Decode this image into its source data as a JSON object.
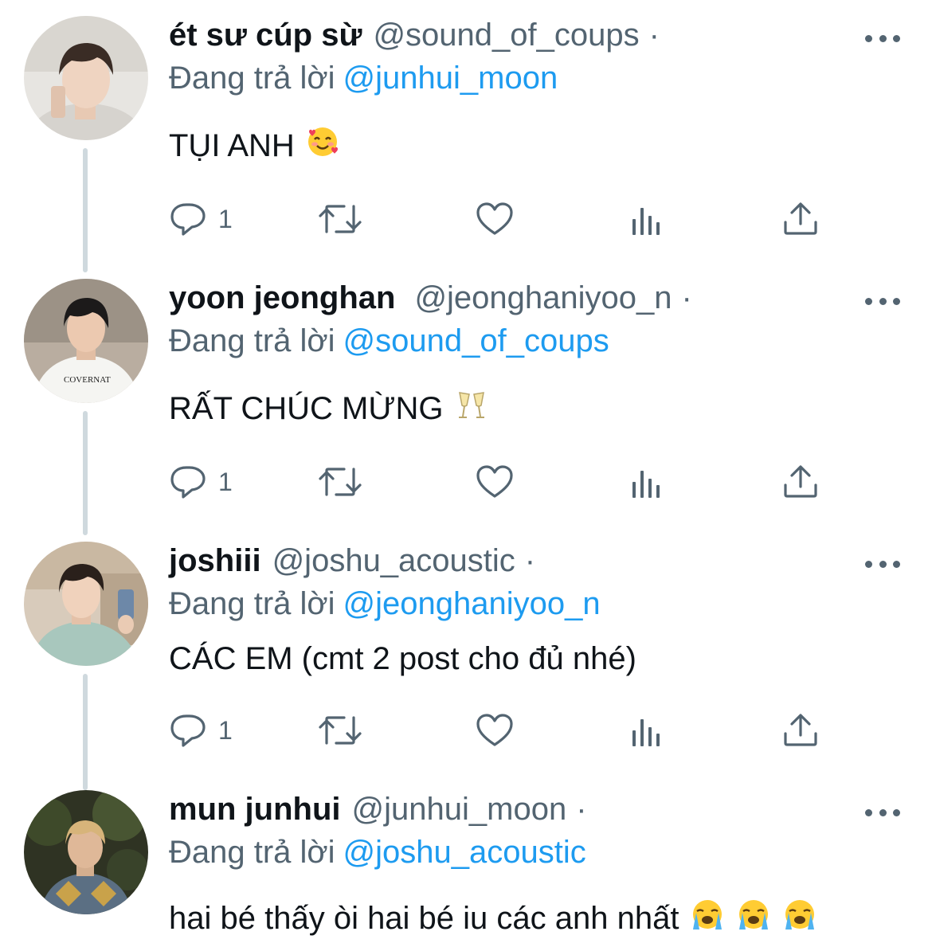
{
  "tweets": [
    {
      "name": "ét sư cúp sừ",
      "handle": "@sound_of_coups",
      "dot": "·",
      "replying_prefix": "Đang trả lời",
      "replying_to": "@junhui_moon",
      "text": "TỤI ANH",
      "emoji": "smiling-face-with-hearts",
      "reply_count": "1"
    },
    {
      "name": "yoon jeonghan",
      "handle": "@jeonghaniyoo_n",
      "dot": "·",
      "replying_prefix": "Đang trả lời",
      "replying_to": "@sound_of_coups",
      "text": "RẤT CHÚC MỪNG",
      "emoji": "clinking-glasses",
      "reply_count": "1"
    },
    {
      "name": "joshiii",
      "handle": "@joshu_acoustic",
      "dot": "·",
      "replying_prefix": "Đang trả lời",
      "replying_to": "@jeonghaniyoo_n",
      "text": "CÁC EM (cmt 2 post cho đủ nhé)",
      "reply_count": "1"
    },
    {
      "name": "mun junhui",
      "handle": "@junhui_moon",
      "dot": "·",
      "replying_prefix": "Đang trả lời",
      "replying_to": "@joshu_acoustic",
      "text": "hai bé thấy òi hai bé iu các anh nhất",
      "emoji": "loudly-crying-face"
    }
  ],
  "icons": {
    "reply": "reply-icon",
    "retweet": "retweet-icon",
    "like": "like-icon",
    "views": "views-icon",
    "share": "share-icon",
    "more": "more-options-icon"
  },
  "colors": {
    "link": "#1d9bf0",
    "secondary_text": "#536471",
    "primary_text": "#0f1419",
    "thread_line": "#cfd9de"
  }
}
